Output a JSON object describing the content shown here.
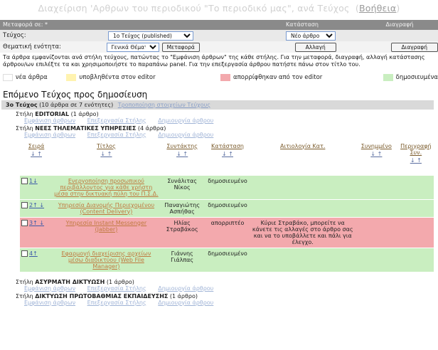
{
  "page": {
    "title": "Διαχείριση 'Αρθρων του περιοδικού \"Το περιοδικό μας\", ανά Τεύχος",
    "help_link": "Βοήθεια"
  },
  "panel": {
    "head_transfer_to": "Μεταφορά σε: *",
    "head_status": "Κατάσταση",
    "head_delete": "Διαγραφή",
    "issue_label": "Τεύχος:",
    "issue_value": "1ο Τεύχος (published)",
    "status_value": "Νέο άρθρο",
    "column_label": "Θεματική ενότητα:",
    "column_value": "Γενικά Θέματα",
    "transfer_button": "Μεταφορά",
    "change_button": "Αλλαγή",
    "delete_button": "Διαγραφή"
  },
  "info_text": "Τα άρθρα εμφανίζονται ανά στήλη τεύχους, πατώντας το \"Εμφάνιση άρθρων\" της κάθε στήλης. Για την μεταφορά, διαγραφή, αλλαγή κατάστασης άρθρου/ων επιλέξτε τα και χρησιμοποιήστε το παραπάνω panel. Για την επεξεργασία άρθρου πατήστε πάνω στον τίτλο του.",
  "legend": {
    "new": "νέα άρθρα",
    "submitted": "υποβληθέντα στον editor",
    "rejected": "απορρίφθηκαν από τον editor",
    "published": "δημοσιευμένα",
    "colors": {
      "new": "#ffffff",
      "submitted": "#fff3b0",
      "rejected": "#f3a9ad",
      "published": "#c9eec0"
    }
  },
  "next_issue": {
    "heading": "Επόμενο Τεύχος προς δημοσίευση",
    "issue_bold": "3ο Τεύχος",
    "issue_rest": " (10 άρθρα σε 7 ενότητες)",
    "edit_issue_link": "Τροποποίηση στοιχείων Τεύχους"
  },
  "links": {
    "show": "Εμφάνιση άρθρων",
    "edit_column": "Επεξεργασία Στήλης",
    "create": "Δημιουργία άρθρου"
  },
  "columns": [
    {
      "prefix": "Στήλη ",
      "name": "EDITORIAL",
      "count": " (1 άρθρο)"
    },
    {
      "prefix": "Στήλη ",
      "name": "ΝΕΕΣ ΤΗΛΕΜΑΤΙΚΕΣ ΥΠΗΡΕΣΙΕΣ",
      "count": " (4 άρθρα)"
    },
    {
      "prefix": "Στήλη ",
      "name": "ΑΣΥΡΜΑΤΗ ΔΙΚΤΥΩΣΗ",
      "count": " (1 άρθρο)"
    },
    {
      "prefix": "Στήλη ",
      "name": "ΔΙΚΤΥΩΣΗ ΠΡΩΤΟΒΑΘΜΙΑΣ ΕΚΠΑΙΔΕΥΣΗΣ",
      "count": " (1 άρθρο)"
    }
  ],
  "table": {
    "headers": [
      "Σειρά",
      "Τίτλος",
      "Συντάκτης",
      "Κατάσταση",
      "Αιτιολογία Κατ.",
      "Συνημμένο",
      "Περιγραφή Συν."
    ],
    "sort_arrows": "↓ ↑",
    "rows": [
      {
        "order": "1↓",
        "title": "Ενεργοποίηση προσωπικού περιβάλλοντος για κάθε χρήστη μέσα στην δικτυακή πύλη του Π.Σ.Δ.",
        "author": "Συνάλιτας Νίκος",
        "status": "δημοσιευμένο",
        "reason": "",
        "state": "green"
      },
      {
        "order": "2↑ ↓",
        "title": "Υπηρεσία Διανομής Περιεχομένου (Content Delivery)",
        "author": "Παναγιώτης Ασπήθας",
        "status": "δημοσιευμένο",
        "reason": "",
        "state": "green"
      },
      {
        "order": "3↑ ↓",
        "title": "Υπηρεσία Instant Messenger (Jabber)",
        "author": "Ηλίας Στραβάκος",
        "status": "απορριπτέο",
        "reason": "Κύριε Στραβάκο, μπορείτε να κάνετε τις αλλαγές στο άρθρο σας και να το υποβάλλετε και πάλι για έλεγχο.",
        "state": "red"
      },
      {
        "order": "4↑",
        "title": "Εφαρμογή διαχείρισης αρχείων μέσω διαδικτύου (Web File Manager)",
        "author": "Γιάννης Γιάλπας",
        "status": "δημοσιευμένο",
        "reason": "",
        "state": "green"
      }
    ]
  }
}
